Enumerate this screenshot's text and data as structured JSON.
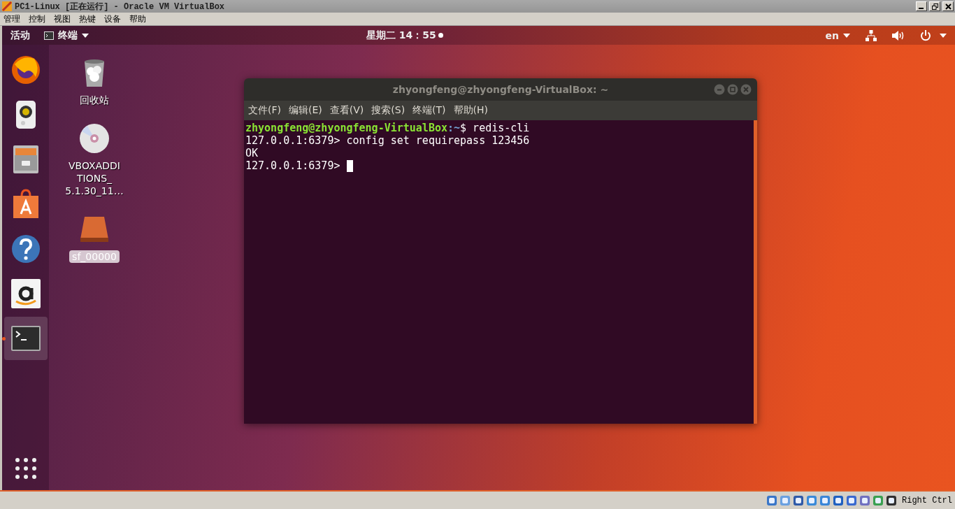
{
  "vbox_window": {
    "title": "PC1-Linux [正在运行] - Oracle VM VirtualBox",
    "menu": [
      "管理",
      "控制",
      "视图",
      "热键",
      "设备",
      "帮助"
    ],
    "status_bar": {
      "host_key": "Right Ctrl"
    }
  },
  "top_bar": {
    "activities": "活动",
    "app_menu": "终端",
    "clock": "星期二 14：55",
    "notification": true,
    "language": "en"
  },
  "dock": {
    "items": [
      {
        "kind": "browser",
        "active": false
      },
      {
        "kind": "music",
        "active": false
      },
      {
        "kind": "files",
        "active": false
      },
      {
        "kind": "store",
        "active": false
      },
      {
        "kind": "help",
        "active": false
      },
      {
        "kind": "shop",
        "active": false
      },
      {
        "kind": "terminal",
        "active": true
      }
    ]
  },
  "desktop_icons": [
    {
      "kind": "trash",
      "label": "回收站",
      "selected": false
    },
    {
      "kind": "disc",
      "label": "VBOXADDI\nTIONS_\n5.1.30_11…",
      "selected": false
    },
    {
      "kind": "drive",
      "label": "sf_00000",
      "selected": true
    }
  ],
  "terminal": {
    "title": "zhyongfeng@zhyongfeng-VirtualBox: ~",
    "menu": [
      "文件(F)",
      "编辑(E)",
      "查看(V)",
      "搜索(S)",
      "终端(T)",
      "帮助(H)"
    ],
    "lines": [
      {
        "kind": "shell",
        "user": "zhyongfeng@zhyongfeng-VirtualBox",
        "path": ":~",
        "text": "$ redis-cli",
        "cursor": false
      },
      {
        "kind": "plain",
        "text": "127.0.0.1:6379> config set requirepass 123456",
        "cursor": false
      },
      {
        "kind": "plain",
        "text": "OK",
        "cursor": false
      },
      {
        "kind": "plain",
        "text": "127.0.0.1:6379> ",
        "cursor": true
      }
    ]
  }
}
